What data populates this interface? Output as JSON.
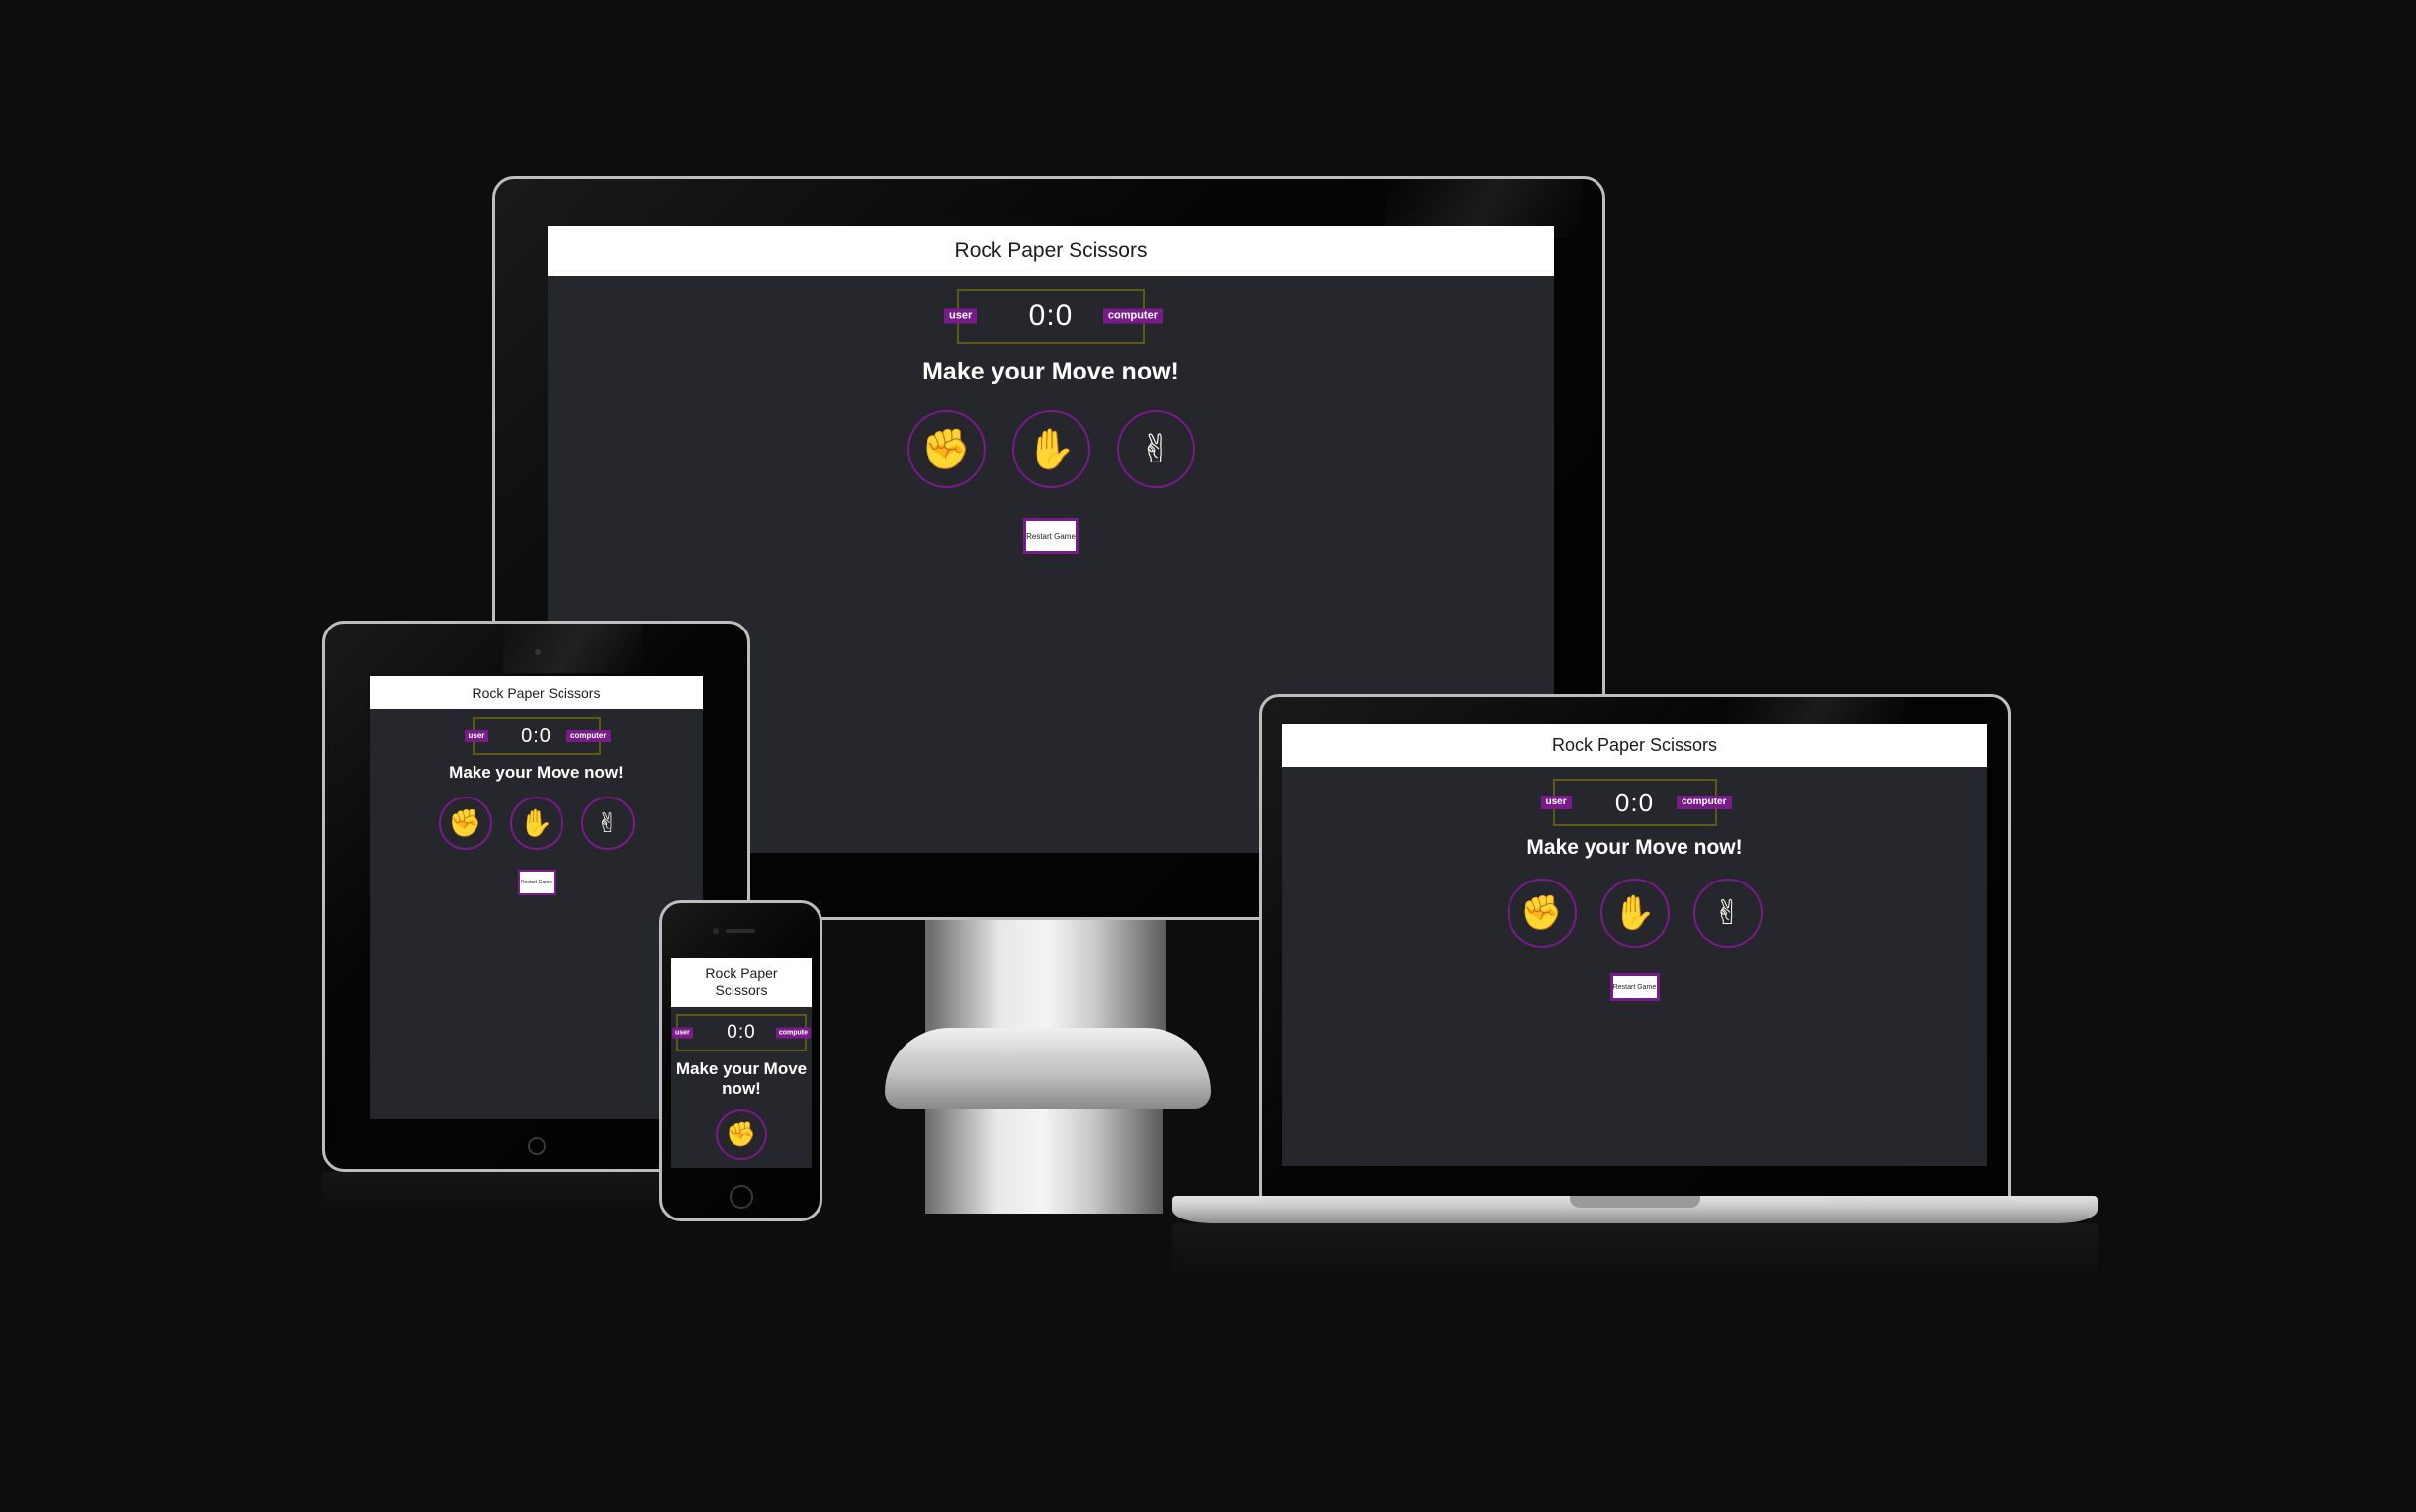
{
  "app": {
    "title": "Rock Paper Scissors",
    "title_line1": "Rock Paper",
    "title_line2": "Scissors",
    "score": "0:0",
    "user_label": "user",
    "computer_label": "computer",
    "computer_label_short": "compute",
    "message": "Make your Move now!",
    "message_line1": "Make your Move",
    "message_line2": "now!",
    "restart_label": "Restart Game",
    "restart_label_short": "Restart Game"
  },
  "choices": [
    {
      "name": "rock",
      "icon": "fist-icon",
      "glyph": "✊"
    },
    {
      "name": "paper",
      "icon": "raised-hand-icon",
      "glyph": "✋"
    },
    {
      "name": "scissors",
      "icon": "victory-hand-icon",
      "glyph": "✌"
    }
  ],
  "colors": {
    "background": "#0d0d0e",
    "screen": "#26272c",
    "header": "#ffffff",
    "accent_purple": "#7a1b8c",
    "score_border": "#5d5a14",
    "hand": "#f4b660"
  }
}
